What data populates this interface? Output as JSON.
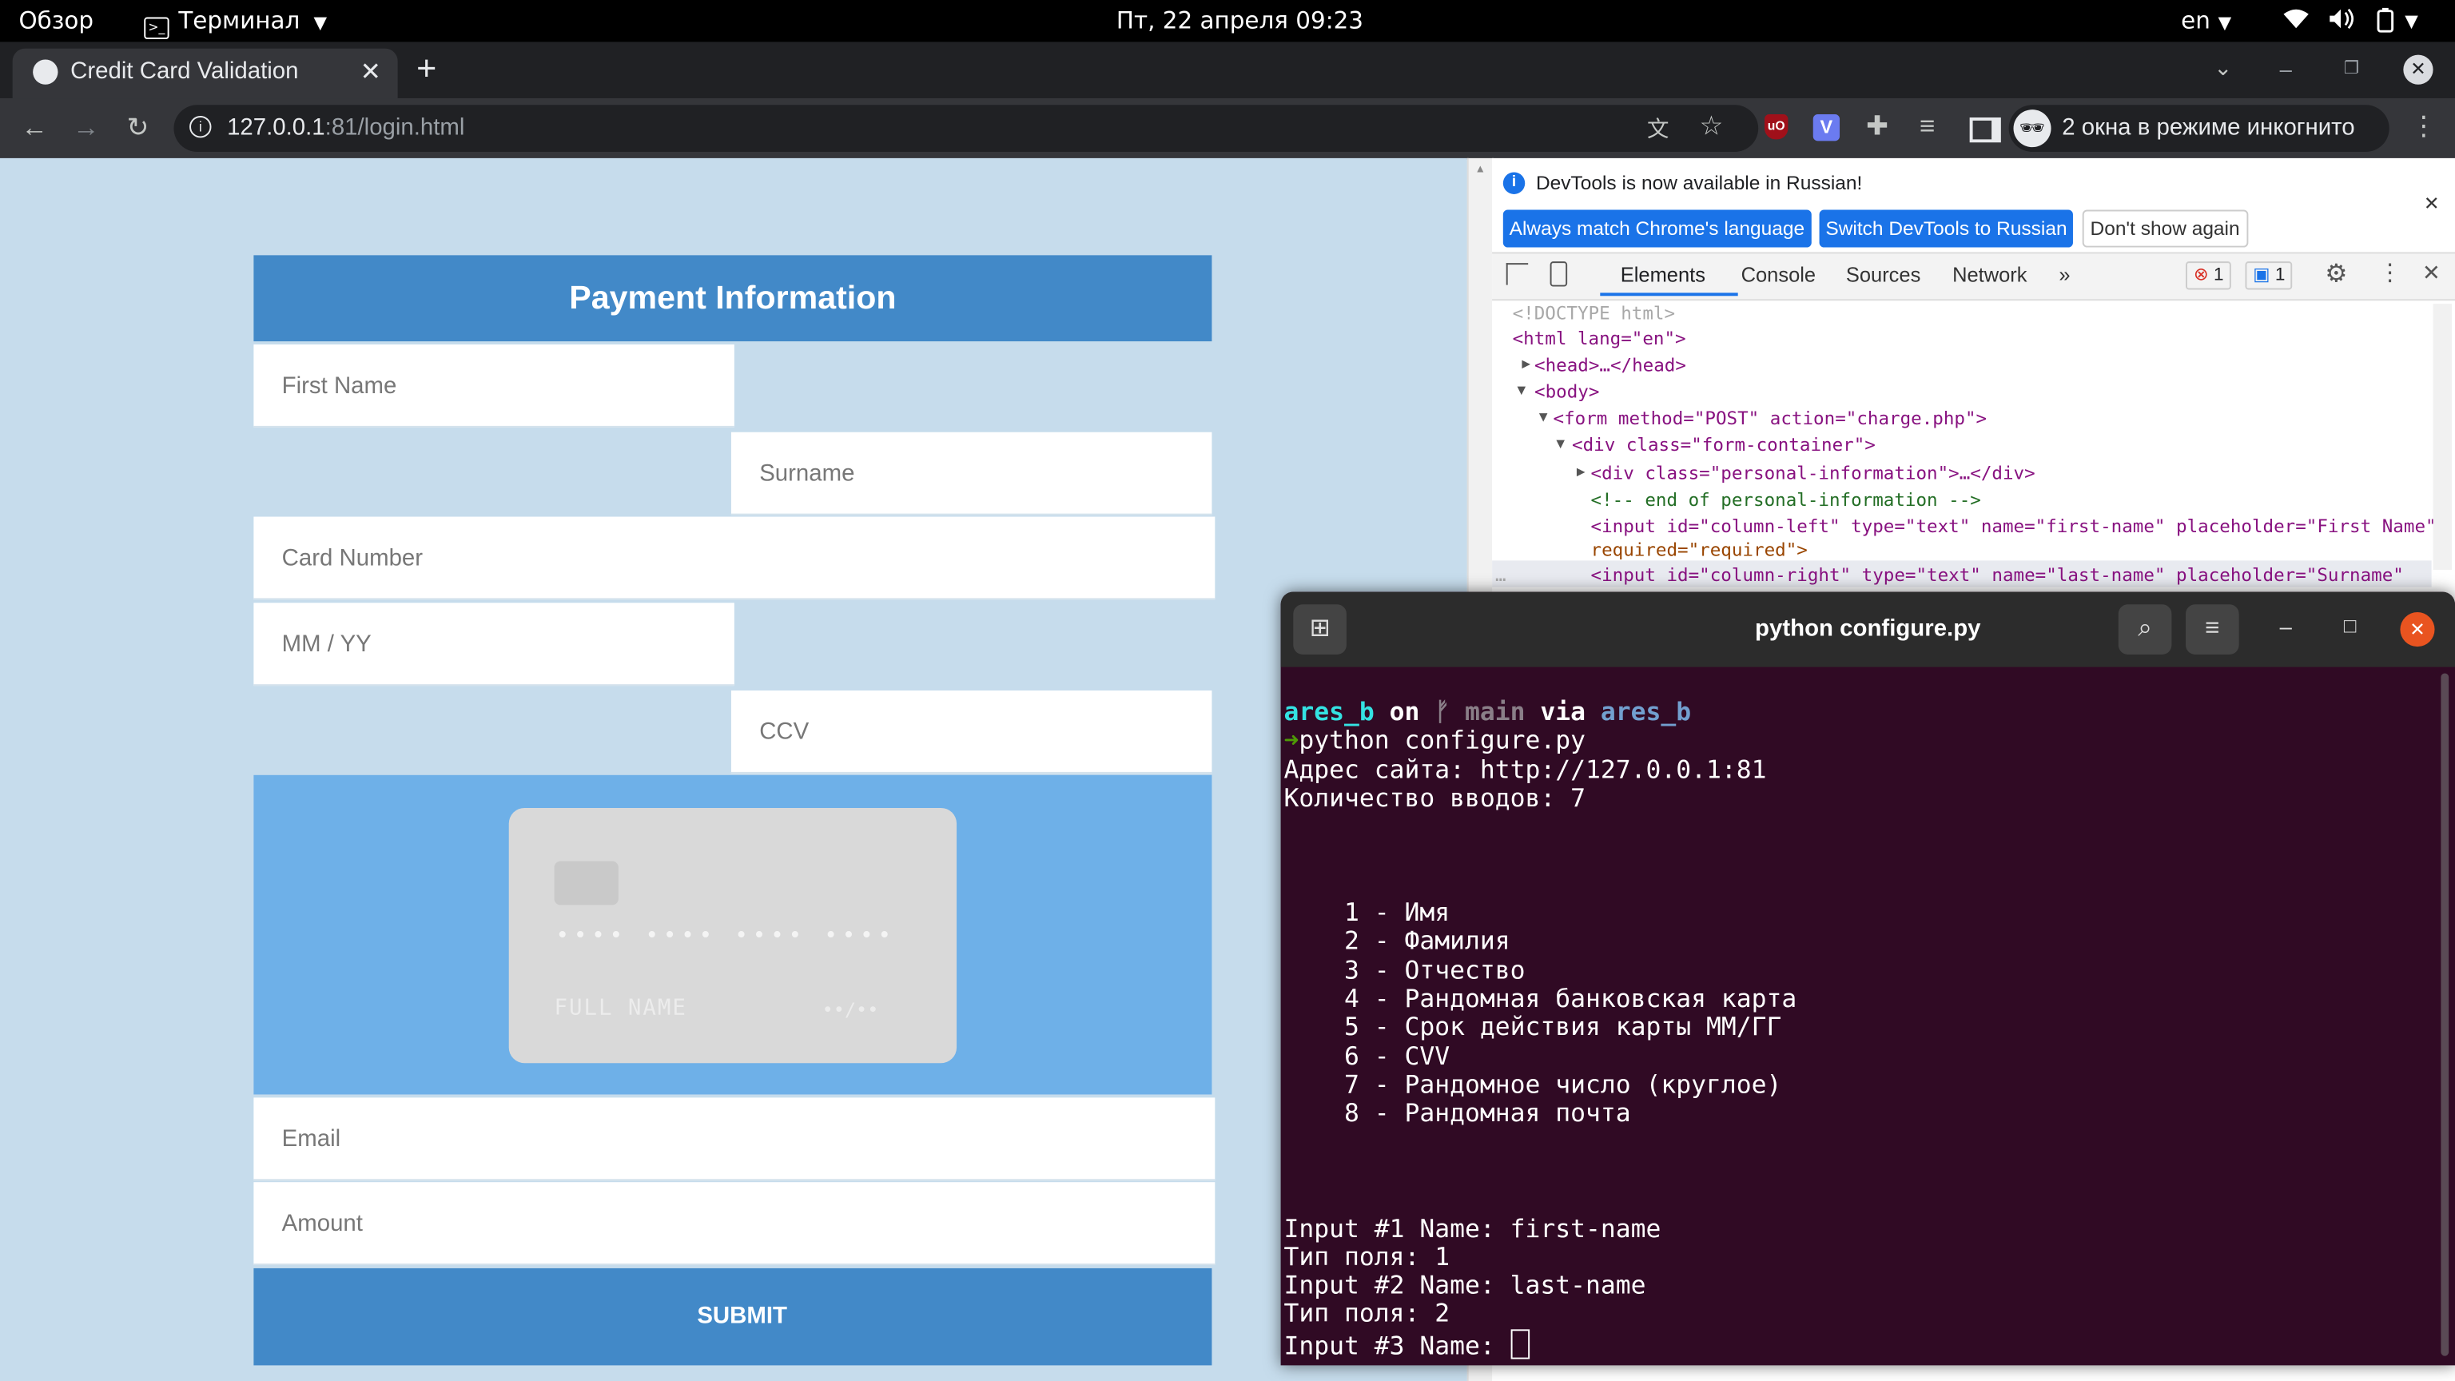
{
  "topbar": {
    "activities": "Обзор",
    "app_menu": "Терминал",
    "clock": "Пт, 22 апреля  09:23",
    "lang": "en"
  },
  "browser": {
    "tab_title": "Credit Card Validation",
    "url_host": "127.0.0.1",
    "url_rest": ":81/login.html",
    "incognito_label": "2 окна в режиме инкогнито"
  },
  "form": {
    "title": "Payment Information",
    "first_name_ph": "First Name",
    "surname_ph": "Surname",
    "card_number_ph": "Card Number",
    "expiry_ph": "MM / YY",
    "ccv_ph": "CCV",
    "card_dots": "•••• •••• •••• ••••",
    "card_name": "FULL NAME",
    "card_expiry": "••/••",
    "email_ph": "Email",
    "amount_ph": "Amount",
    "submit": "SUBMIT"
  },
  "devtools": {
    "banner": "DevTools is now available in Russian!",
    "btn_match": "Always match Chrome's language",
    "btn_switch": "Switch DevTools to Russian",
    "btn_dont": "Don't show again",
    "tabs": [
      "Elements",
      "Console",
      "Sources",
      "Network"
    ],
    "errors": "1",
    "messages": "1",
    "code": {
      "doctype": "<!DOCTYPE html>",
      "html": "<html lang=\"en\">",
      "head": "<head>…</head>",
      "body": "<body>",
      "form": "<form method=\"POST\" action=\"charge.php\">",
      "div_fc": "<div class=\"form-container\">",
      "div_pi": "<div class=\"personal-information\">…</div>",
      "comment": "<!-- end of personal-information -->",
      "input1": "<input id=\"column-left\" type=\"text\" name=\"first-name\" placeholder=\"First Name\"",
      "input1b": "required=\"required\">",
      "input2": "<input id=\"column-right\" type=\"text\" name=\"last-name\" placeholder=\"Surname\""
    }
  },
  "terminal": {
    "title": "python configure.py",
    "prompt_user": "ares_b",
    "prompt_on": "on",
    "prompt_branch": "main",
    "prompt_via": "via",
    "prompt_env": "ares_b",
    "command": "python configure.py",
    "lines_top": [
      "Адрес сайта: http://127.0.0.1:81",
      "Количество вводов: 7"
    ],
    "options": [
      "    1 - Имя",
      "    2 - Фамилия",
      "    3 - Отчество",
      "    4 - Рандомная банковская карта",
      "    5 - Срок действия карты ММ/ГГ",
      "    6 - CVV",
      "    7 - Рандомное число (круглое)",
      "    8 - Рандомная почта"
    ],
    "lines_bottom": [
      "Input #1 Name: first-name",
      "Тип поля: 1",
      "Input #2 Name: last-name",
      "Тип поля: 2"
    ],
    "last_line": "Input #3 Name: "
  }
}
